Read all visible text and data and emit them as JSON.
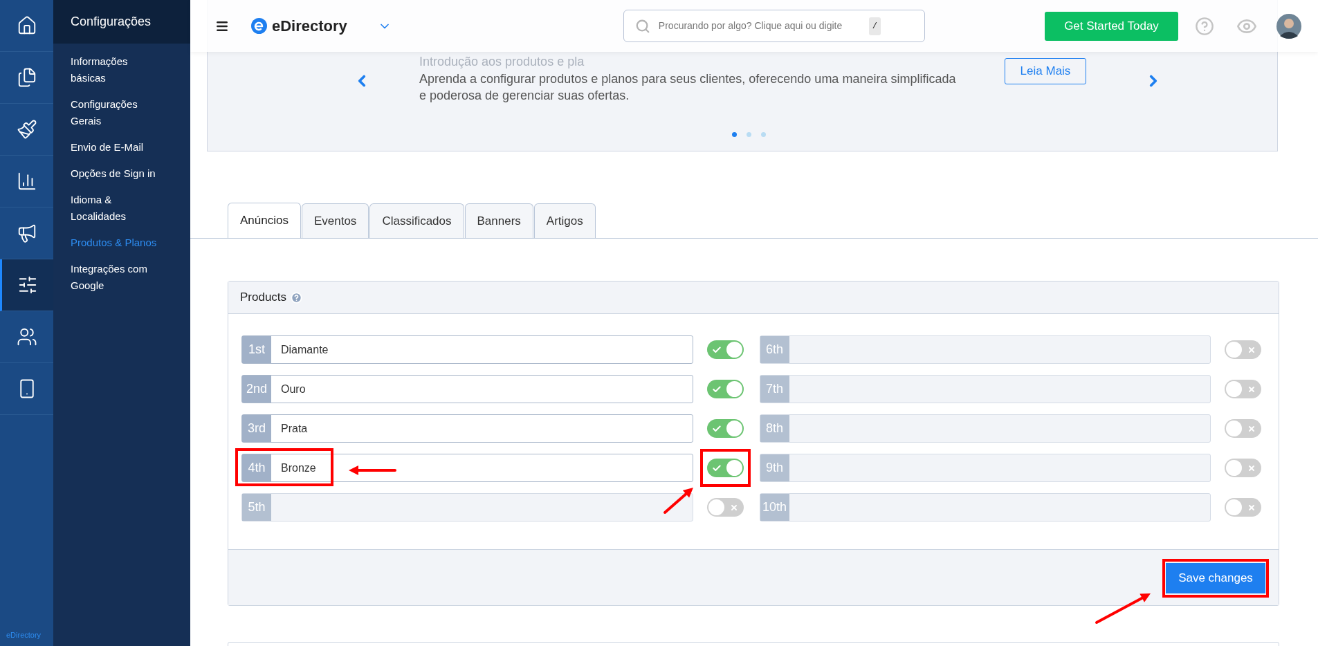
{
  "rail": {
    "items": [
      {
        "selected": false
      },
      {
        "selected": false
      },
      {
        "selected": false
      },
      {
        "selected": false
      },
      {
        "selected": false
      },
      {
        "selected": true
      },
      {
        "selected": false
      },
      {
        "selected": false
      }
    ],
    "brand": "eDirectory"
  },
  "sidebar": {
    "title": "Configurações",
    "items": [
      {
        "label": "Informações básicas",
        "selected": false
      },
      {
        "label": "Configurações Gerais",
        "selected": false
      },
      {
        "label": "Envio de E-Mail",
        "selected": false
      },
      {
        "label": "Opções de Sign in",
        "selected": false
      },
      {
        "label": "Idioma & Localidades",
        "selected": false
      },
      {
        "label": "Produtos & Planos",
        "selected": true
      },
      {
        "label": "Integrações com Google",
        "selected": false
      }
    ]
  },
  "topbar": {
    "brand": "eDirectory",
    "search": {
      "placeholder": "Procurando por algo? Clique aqui ou digite",
      "shortcut": "/"
    },
    "cta": "Get Started Today"
  },
  "banner": {
    "title": "Introdução aos produtos e pla",
    "text": "Aprenda a configurar produtos e planos para seus clientes, oferecendo uma maneira simplificada e poderosa de gerenciar suas ofertas.",
    "button": "Leia Mais",
    "dots": [
      {
        "selected": true
      },
      {
        "selected": false
      },
      {
        "selected": false
      }
    ]
  },
  "tabs": [
    {
      "label": "Anúncios",
      "selected": true
    },
    {
      "label": "Eventos",
      "selected": false
    },
    {
      "label": "Classificados",
      "selected": false
    },
    {
      "label": "Banners",
      "selected": false
    },
    {
      "label": "Artigos",
      "selected": false
    }
  ],
  "products": {
    "title": "Products",
    "items": [
      {
        "rank": "1st",
        "name": "Diamante",
        "enabled": true,
        "highlighted": false
      },
      {
        "rank": "2nd",
        "name": "Ouro",
        "enabled": true,
        "highlighted": false
      },
      {
        "rank": "3rd",
        "name": "Prata",
        "enabled": true,
        "highlighted": false
      },
      {
        "rank": "4th",
        "name": "Bronze",
        "enabled": true,
        "highlighted": true
      },
      {
        "rank": "5th",
        "enabled": false,
        "highlighted": false
      },
      {
        "rank": "6th",
        "enabled": false,
        "highlighted": false
      },
      {
        "rank": "7th",
        "enabled": false,
        "highlighted": false
      },
      {
        "rank": "8th",
        "enabled": false,
        "highlighted": false
      },
      {
        "rank": "9th",
        "enabled": false,
        "highlighted": false
      },
      {
        "rank": "10th",
        "enabled": false,
        "highlighted": false
      }
    ]
  },
  "save": {
    "label": "Save changes",
    "highlighted": true
  }
}
